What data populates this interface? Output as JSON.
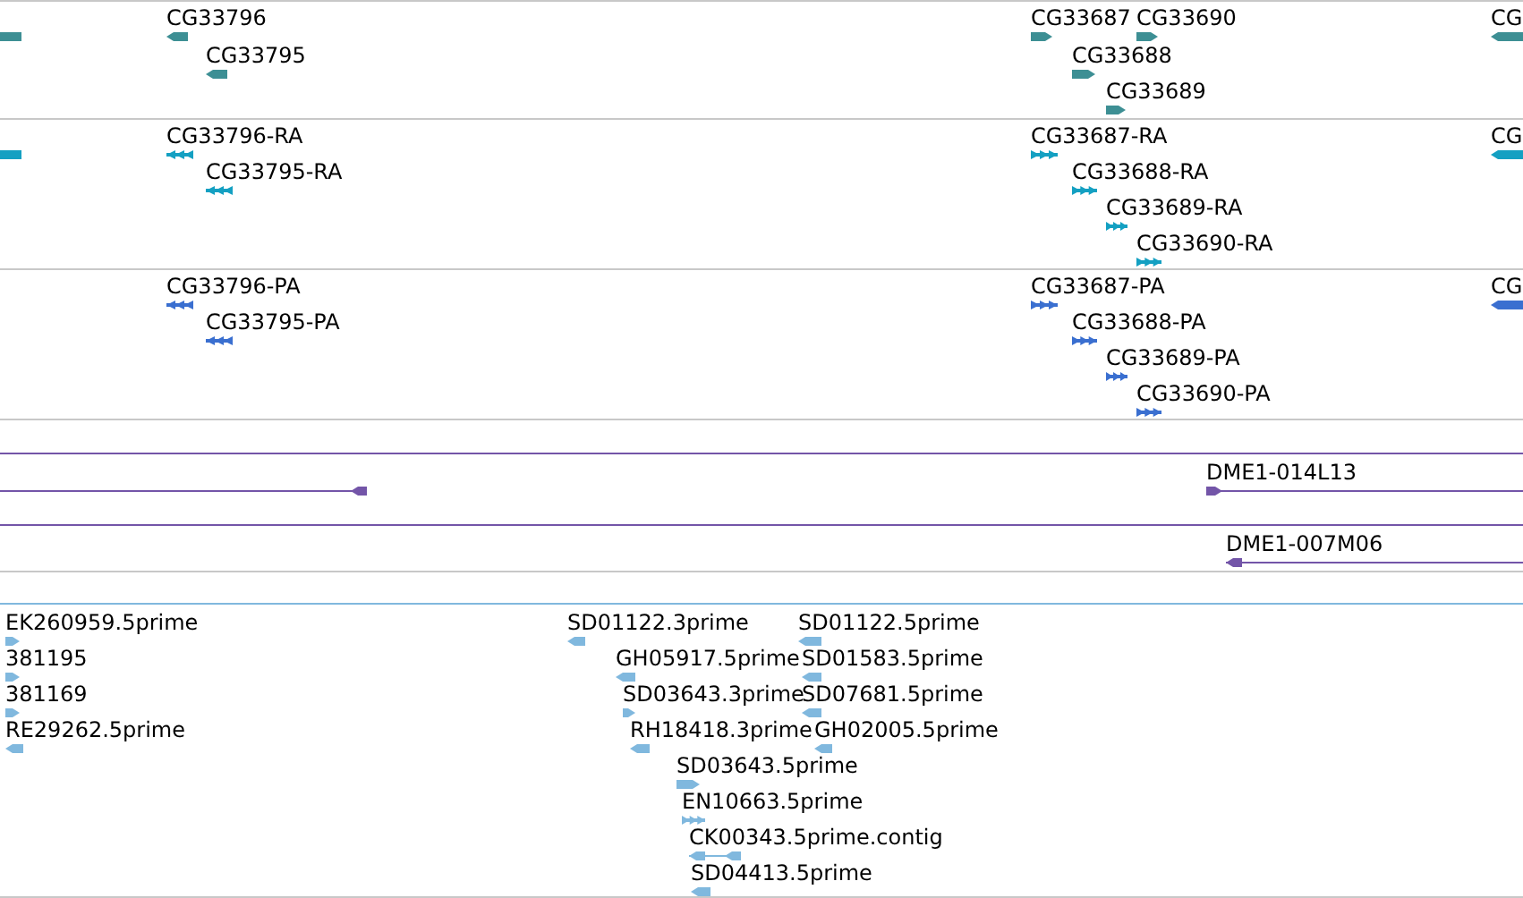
{
  "tracks": [
    {
      "color": "#3d8f94",
      "features": [
        {
          "kind": "bar"
        },
        {
          "label": "CG33796",
          "kind": "arrow",
          "reverse": true
        },
        {
          "label": "CG33795",
          "kind": "arrow",
          "reverse": true
        },
        {
          "label": "CG33687",
          "kind": "arrow",
          "reverse": false
        },
        {
          "label": "CG33690",
          "kind": "arrow",
          "reverse": false
        },
        {
          "label": "CG33688",
          "kind": "arrow",
          "reverse": false
        },
        {
          "label": "CG33689",
          "kind": "arrow",
          "reverse": false
        },
        {
          "label": "CG",
          "kind": "arrow",
          "reverse": true
        }
      ]
    },
    {
      "color": "#14a0c2",
      "features": [
        {
          "kind": "bar"
        },
        {
          "label": "CG33796-RA",
          "kind": "exons",
          "reverse": true
        },
        {
          "label": "CG33795-RA",
          "kind": "exons",
          "reverse": true
        },
        {
          "label": "CG33687-RA",
          "kind": "exons",
          "reverse": false
        },
        {
          "label": "CG33688-RA",
          "kind": "exons",
          "reverse": false
        },
        {
          "label": "CG33689-RA",
          "kind": "exons",
          "reverse": false
        },
        {
          "label": "CG33690-RA",
          "kind": "exons",
          "reverse": false
        },
        {
          "label": "CG",
          "kind": "arrow",
          "reverse": true
        }
      ]
    },
    {
      "color": "#3a6fd0",
      "features": [
        {
          "label": "CG33796-PA",
          "kind": "exons",
          "reverse": true
        },
        {
          "label": "CG33795-PA",
          "kind": "exons",
          "reverse": true
        },
        {
          "label": "CG33687-PA",
          "kind": "exons",
          "reverse": false
        },
        {
          "label": "CG33688-PA",
          "kind": "exons",
          "reverse": false
        },
        {
          "label": "CG33689-PA",
          "kind": "exons",
          "reverse": false
        },
        {
          "label": "CG33690-PA",
          "kind": "exons",
          "reverse": false
        },
        {
          "label": "CG",
          "kind": "arrow",
          "reverse": true
        }
      ]
    },
    {
      "color": "#7355a8",
      "features": [
        {
          "kind": "clone",
          "reverse": true
        },
        {
          "label": "DME1-014L13",
          "kind": "clone",
          "reverse": false
        }
      ]
    },
    {
      "color": "#7355a8",
      "features": [
        {
          "label": "DME1-007M06",
          "kind": "clone",
          "reverse": true
        }
      ]
    },
    {
      "color": "#80b8de",
      "features": [
        {
          "label": "EK260959.5prime",
          "kind": "arrow",
          "reverse": false
        },
        {
          "label": "381195",
          "kind": "arrow",
          "reverse": false
        },
        {
          "label": "381169",
          "kind": "arrow",
          "reverse": false
        },
        {
          "label": "RE29262.5prime",
          "kind": "arrow",
          "reverse": true
        },
        {
          "label": "SD01122.3prime",
          "kind": "arrow",
          "reverse": true
        },
        {
          "label": "SD01122.5prime",
          "kind": "arrow",
          "reverse": true
        },
        {
          "label": "GH05917.5prime",
          "kind": "arrow",
          "reverse": true
        },
        {
          "label": "SD01583.5prime",
          "kind": "arrow",
          "reverse": true
        },
        {
          "label": "SD03643.3prime",
          "kind": "arrow",
          "reverse": false
        },
        {
          "label": "SD07681.5prime",
          "kind": "arrow",
          "reverse": true
        },
        {
          "label": "RH18418.3prime",
          "kind": "arrow",
          "reverse": true
        },
        {
          "label": "GH02005.5prime",
          "kind": "arrow",
          "reverse": true
        },
        {
          "label": "SD03643.5prime",
          "kind": "arrow",
          "reverse": false
        },
        {
          "label": "EN10663.5prime",
          "kind": "exons",
          "reverse": false
        },
        {
          "label": "CK00343.5prime.contig",
          "kind": "pair",
          "reverse": true
        },
        {
          "label": "SD04413.5prime",
          "kind": "arrow",
          "reverse": true
        }
      ]
    }
  ]
}
